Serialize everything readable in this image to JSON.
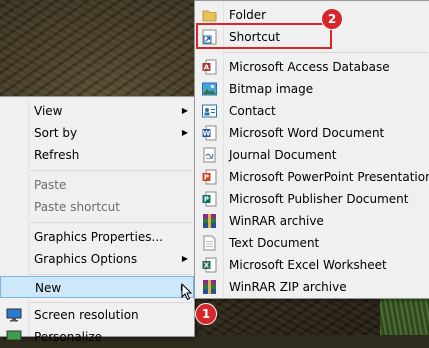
{
  "context_menu": {
    "items": [
      {
        "label": "View",
        "submenu": true
      },
      {
        "label": "Sort by",
        "submenu": true
      },
      {
        "label": "Refresh"
      },
      {
        "label": "Paste",
        "disabled": true
      },
      {
        "label": "Paste shortcut",
        "disabled": true
      },
      {
        "label": "Graphics Properties..."
      },
      {
        "label": "Graphics Options",
        "submenu": true
      },
      {
        "label": "New",
        "submenu": true,
        "highlighted": true
      },
      {
        "label": "Screen resolution"
      },
      {
        "label": "Personalize"
      }
    ]
  },
  "new_submenu": {
    "items": [
      {
        "label": "Folder",
        "icon": "folder-icon"
      },
      {
        "label": "Shortcut",
        "icon": "shortcut-icon"
      },
      {
        "label": "Microsoft Access Database",
        "icon": "access-icon"
      },
      {
        "label": "Bitmap image",
        "icon": "bitmap-icon"
      },
      {
        "label": "Contact",
        "icon": "contact-icon"
      },
      {
        "label": "Microsoft Word Document",
        "icon": "word-icon"
      },
      {
        "label": "Journal Document",
        "icon": "journal-icon"
      },
      {
        "label": "Microsoft PowerPoint Presentation",
        "icon": "powerpoint-icon"
      },
      {
        "label": "Microsoft Publisher Document",
        "icon": "publisher-icon"
      },
      {
        "label": "WinRAR archive",
        "icon": "winrar-icon"
      },
      {
        "label": "Text Document",
        "icon": "text-document-icon"
      },
      {
        "label": "Microsoft Excel Worksheet",
        "icon": "excel-icon"
      },
      {
        "label": "WinRAR ZIP archive",
        "icon": "winrar-zip-icon"
      }
    ]
  },
  "annotations": {
    "step_1": "1",
    "step_2": "2",
    "color": "#d9262a"
  }
}
